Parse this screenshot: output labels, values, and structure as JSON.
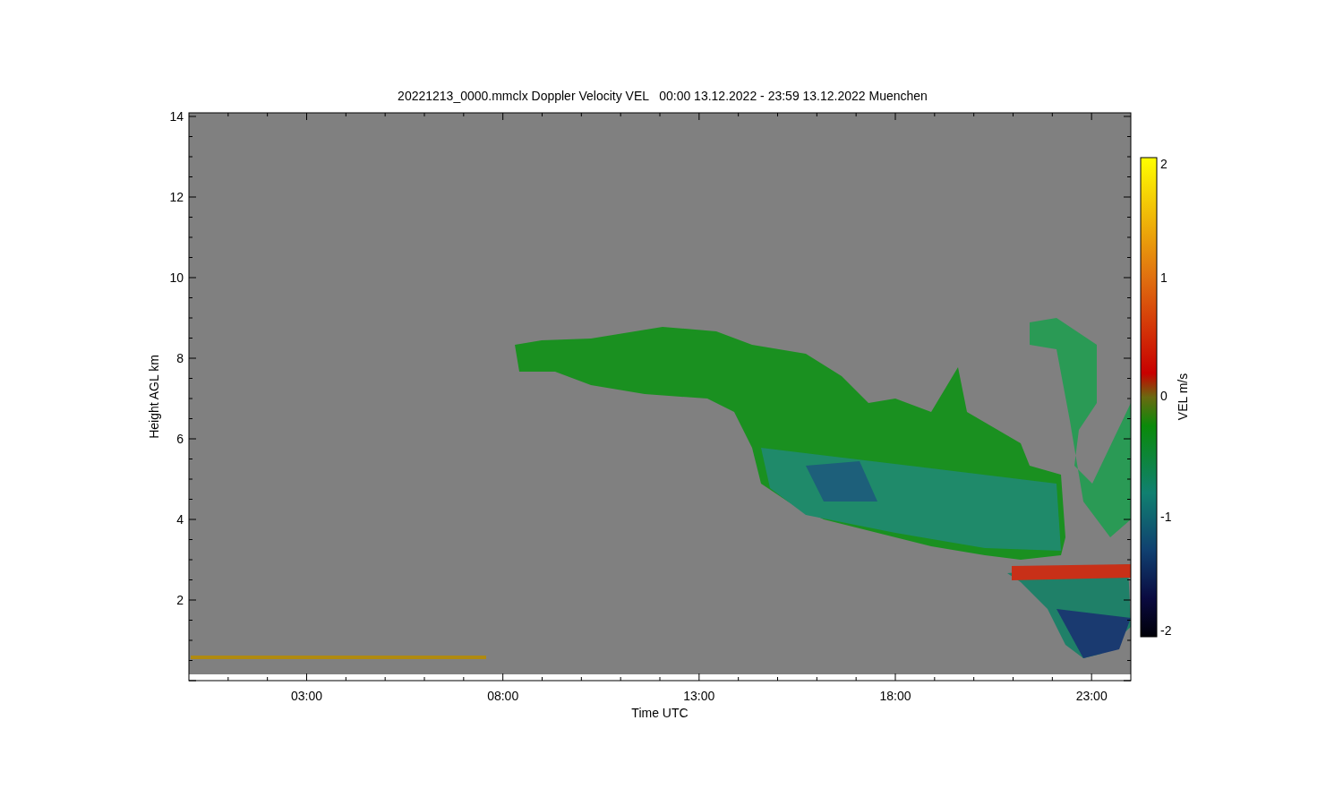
{
  "title": "20221213_0000.mmclx Doppler Velocity VEL   00:00 13.12.2022 - 23:59 13.12.2022 Muenchen",
  "y_axis": {
    "label": "Height AGL km",
    "ticks": [
      "14",
      "12",
      "10",
      "8",
      "6",
      "4",
      "2"
    ]
  },
  "x_axis": {
    "label": "Time UTC",
    "ticks": [
      "03:00",
      "08:00",
      "13:00",
      "18:00",
      "23:00"
    ]
  },
  "colorbar": {
    "label": "VEL m/s",
    "ticks": [
      "2",
      "1",
      "0",
      "-1",
      "-2"
    ]
  }
}
